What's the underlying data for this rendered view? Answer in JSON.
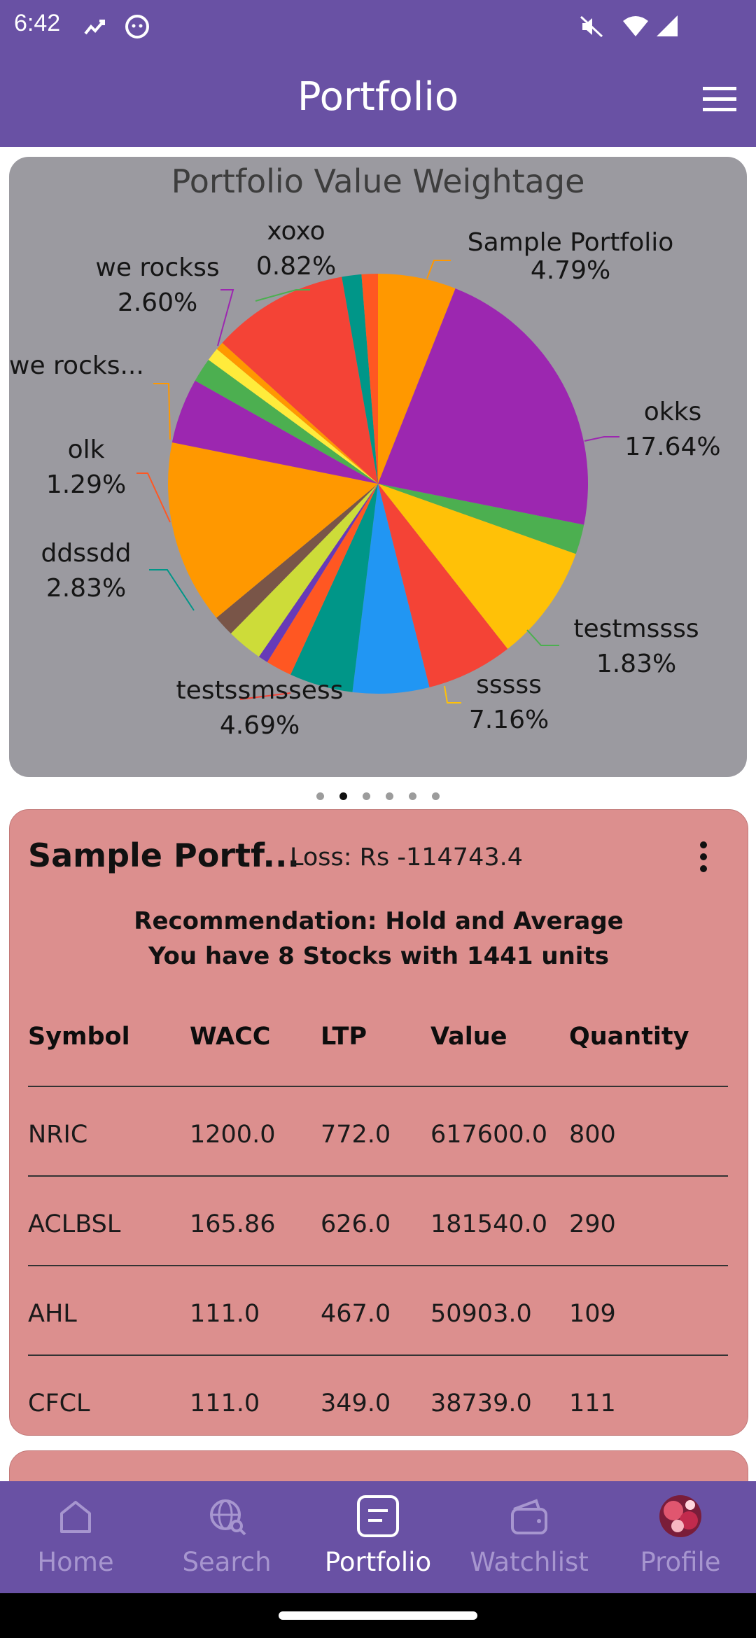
{
  "status_bar": {
    "time": "6:42"
  },
  "app_bar": {
    "title": "Portfolio"
  },
  "chart": {
    "title": "Portfolio Value Weightage",
    "labels": [
      {
        "name": "Sample Portfolio",
        "pct": "4.79%"
      },
      {
        "name": "okks",
        "pct": "17.64%"
      },
      {
        "name": "testmssss",
        "pct": "1.83%"
      },
      {
        "name": "sssss",
        "pct": "7.16%"
      },
      {
        "name": "testssmssess",
        "pct": "4.69%"
      },
      {
        "name": "ddssdd",
        "pct": "2.83%"
      },
      {
        "name": "olk",
        "pct": "1.29%"
      },
      {
        "name": "we rocks...",
        "pct": ""
      },
      {
        "name": "we rockss",
        "pct": "2.60%"
      },
      {
        "name": "xoxo",
        "pct": "0.82%"
      }
    ]
  },
  "chart_data": {
    "type": "pie",
    "title": "Portfolio Value Weightage",
    "slices": [
      {
        "label": "Sample Portfolio",
        "value": 4.79,
        "color": "#ff9800"
      },
      {
        "label": "okks",
        "value": 17.64,
        "color": "#9c27b0"
      },
      {
        "label": "testmssss",
        "value": 1.83,
        "color": "#4caf50"
      },
      {
        "label": "sssss",
        "value": 7.16,
        "color": "#ffc107"
      },
      {
        "label": "",
        "value": 5.3,
        "color": "#f44336"
      },
      {
        "label": "testssmssess",
        "value": 4.69,
        "color": "#2196f3"
      },
      {
        "label": "",
        "value": 3.9,
        "color": "#009688"
      },
      {
        "label": "ddssdd",
        "value": 1.6,
        "color": "#ff5722"
      },
      {
        "label": "",
        "value": 0.6,
        "color": "#673ab7"
      },
      {
        "label": "",
        "value": 2.2,
        "color": "#cddc39"
      },
      {
        "label": "olk",
        "value": 1.29,
        "color": "#795548"
      },
      {
        "label": "we rocks...",
        "value": 11.3,
        "color": "#ff9800"
      },
      {
        "label": "",
        "value": 4.0,
        "color": "#9c27b0"
      },
      {
        "label": "we rockss",
        "value": 1.5,
        "color": "#4caf50"
      },
      {
        "label": "xoxo",
        "value": 0.82,
        "color": "#ffeb3b"
      },
      {
        "label": "",
        "value": 0.5,
        "color": "#ff9800"
      },
      {
        "label": "",
        "value": 8.4,
        "color": "#f44336"
      },
      {
        "label": "",
        "value": 1.2,
        "color": "#009688"
      },
      {
        "label": "",
        "value": 1.0,
        "color": "#ff5722"
      }
    ]
  },
  "carousel": {
    "count": 6,
    "active": 1
  },
  "portfolio": {
    "name": "Sample Portf...",
    "loss": "Loss: Rs -114743.4",
    "recommendation": "Recommendation:  Hold and Average",
    "summary": "You have 8 Stocks with 1441 units",
    "columns": [
      "Symbol",
      "WACC",
      "LTP",
      "Value",
      "Quantity"
    ],
    "rows": [
      [
        "NRIC",
        "1200.0",
        "772.0",
        "617600.0",
        "800"
      ],
      [
        "ACLBSL",
        "165.86",
        "626.0",
        "181540.0",
        "290"
      ],
      [
        "AHL",
        "111.0",
        "467.0",
        "50903.0",
        "109"
      ],
      [
        "CFCL",
        "111.0",
        "349.0",
        "38739.0",
        "111"
      ]
    ]
  },
  "bottom_nav": {
    "items": [
      {
        "label": "Home",
        "icon": "home-icon"
      },
      {
        "label": "Search",
        "icon": "search-globe-icon"
      },
      {
        "label": "Portfolio",
        "icon": "portfolio-icon"
      },
      {
        "label": "Watchlist",
        "icon": "wallet-icon"
      },
      {
        "label": "Profile",
        "icon": "avatar"
      }
    ],
    "active": 2
  }
}
